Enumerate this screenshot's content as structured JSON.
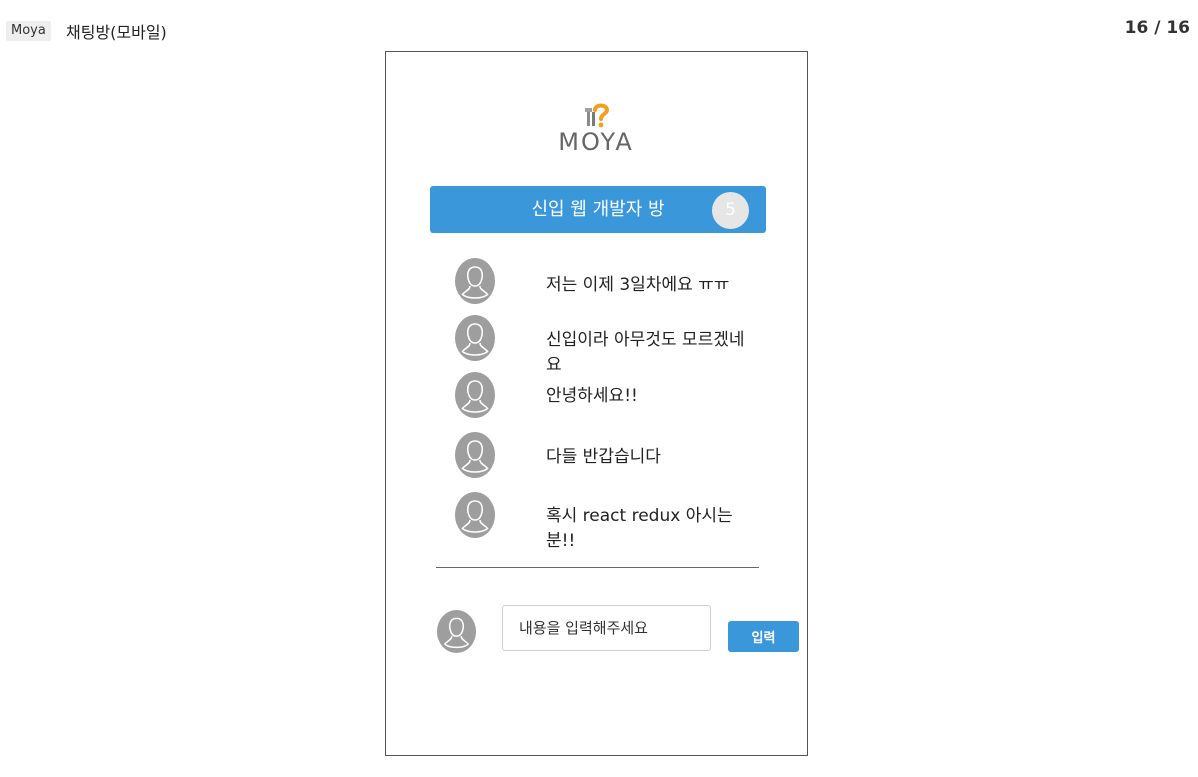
{
  "header": {
    "tag": "Moya",
    "title": "채팅방(모바일)",
    "page_counter": "16 / 16"
  },
  "logo": {
    "text": "MOYA",
    "icon": "tools-question-icon"
  },
  "room": {
    "title": "신입 웹 개발자 방",
    "participant_count": "5"
  },
  "messages": [
    {
      "text": "저는 이제 3일차에요 ㅠㅠ"
    },
    {
      "text": "신입이라 아무것도 모르겠네요"
    },
    {
      "text": "안녕하세요!!"
    },
    {
      "text": "다들 반갑습니다"
    },
    {
      "text": "혹시 react redux 아시는분!!"
    }
  ],
  "composer": {
    "placeholder": "내용을 입력해주세요",
    "submit_label": "입력"
  },
  "colors": {
    "accent": "#3a97d9",
    "avatar": "#9e9e9e"
  }
}
